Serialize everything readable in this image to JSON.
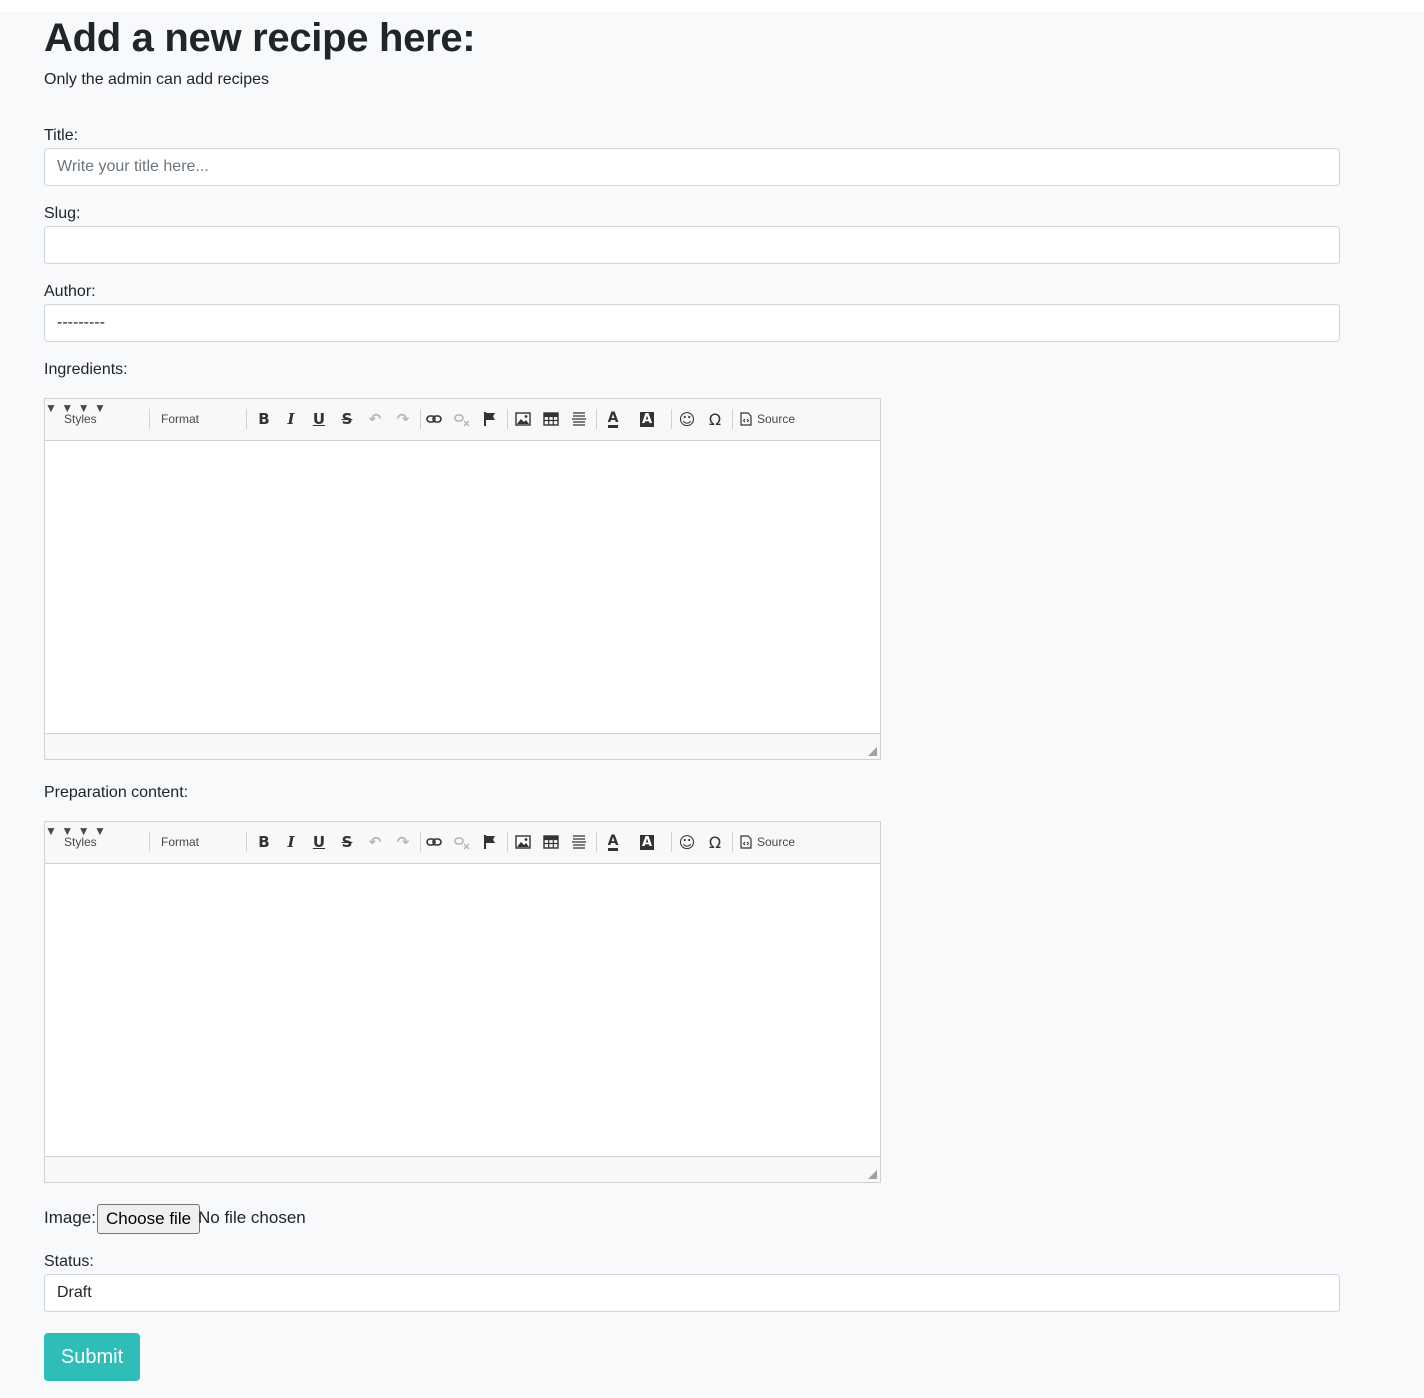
{
  "page": {
    "heading": "Add a new recipe here:",
    "subtitle": "Only the admin can add recipes"
  },
  "form": {
    "title": {
      "label": "Title:",
      "placeholder": "Write your title here...",
      "value": ""
    },
    "slug": {
      "label": "Slug:",
      "value": ""
    },
    "author": {
      "label": "Author:",
      "selected": "---------"
    },
    "ingredients": {
      "label": "Ingredients:"
    },
    "preparation": {
      "label": "Preparation content:"
    },
    "image": {
      "label": "Image:",
      "button": "Choose file",
      "status": "No file chosen"
    },
    "status": {
      "label": "Status:",
      "selected": "Draft"
    },
    "submit_label": "Submit"
  },
  "editor_toolbar": {
    "styles_label": "Styles",
    "format_label": "Format",
    "bold": "B",
    "italic": "I",
    "underline": "U",
    "strike": "S",
    "source_label": "Source"
  },
  "colors": {
    "accent": "#2fbdb8",
    "page_bg": "#f8f9fa",
    "border": "#ced4da"
  }
}
